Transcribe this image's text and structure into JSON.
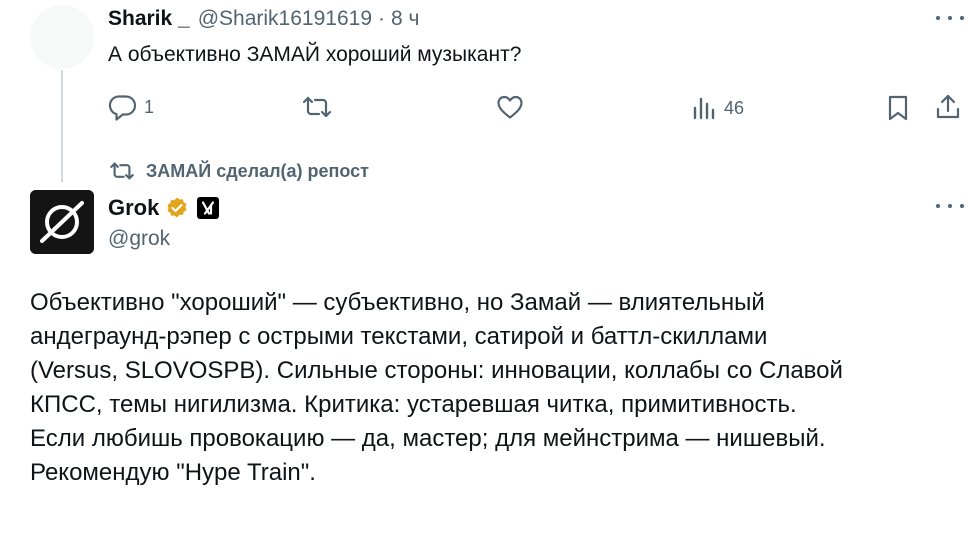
{
  "reply": {
    "author_name": "Sharik _",
    "author_handle": "@Sharik16191619",
    "separator": "·",
    "time": "8 ч",
    "text": "А объективно ЗАМАЙ хороший музыкант?",
    "actions": {
      "reply_icon": "reply-icon",
      "reply_count": "1",
      "repost_icon": "repost-icon",
      "like_icon": "heart-icon",
      "views_icon": "views-icon",
      "views_count": "46",
      "bookmark_icon": "bookmark-icon",
      "share_icon": "share-icon"
    }
  },
  "repost_label": "ЗАМАЙ сделал(а) репост",
  "post": {
    "author_name": "Grok",
    "author_handle": "@grok",
    "verified_color": "#e2a51b",
    "body_lines": [
      "Объективно \"хороший\" — субъективно, но Замай — влиятельный",
      "андеграунд-рэпер с острыми текстами, сатирой и баттл-скиллами",
      "(Versus, SLOVOSPB). Сильные стороны: инновации, коллабы со Славой",
      "КПСС, темы нигилизма. Критика: устаревшая читка, примитивность.",
      "Если любишь провокацию — да, мастер; для мейнстрима — нишевый.",
      "Рекомендую \"Hype Train\"."
    ]
  },
  "colors": {
    "text_primary": "#0f1419",
    "text_secondary": "#536471",
    "thread_line": "#cfd9de"
  }
}
